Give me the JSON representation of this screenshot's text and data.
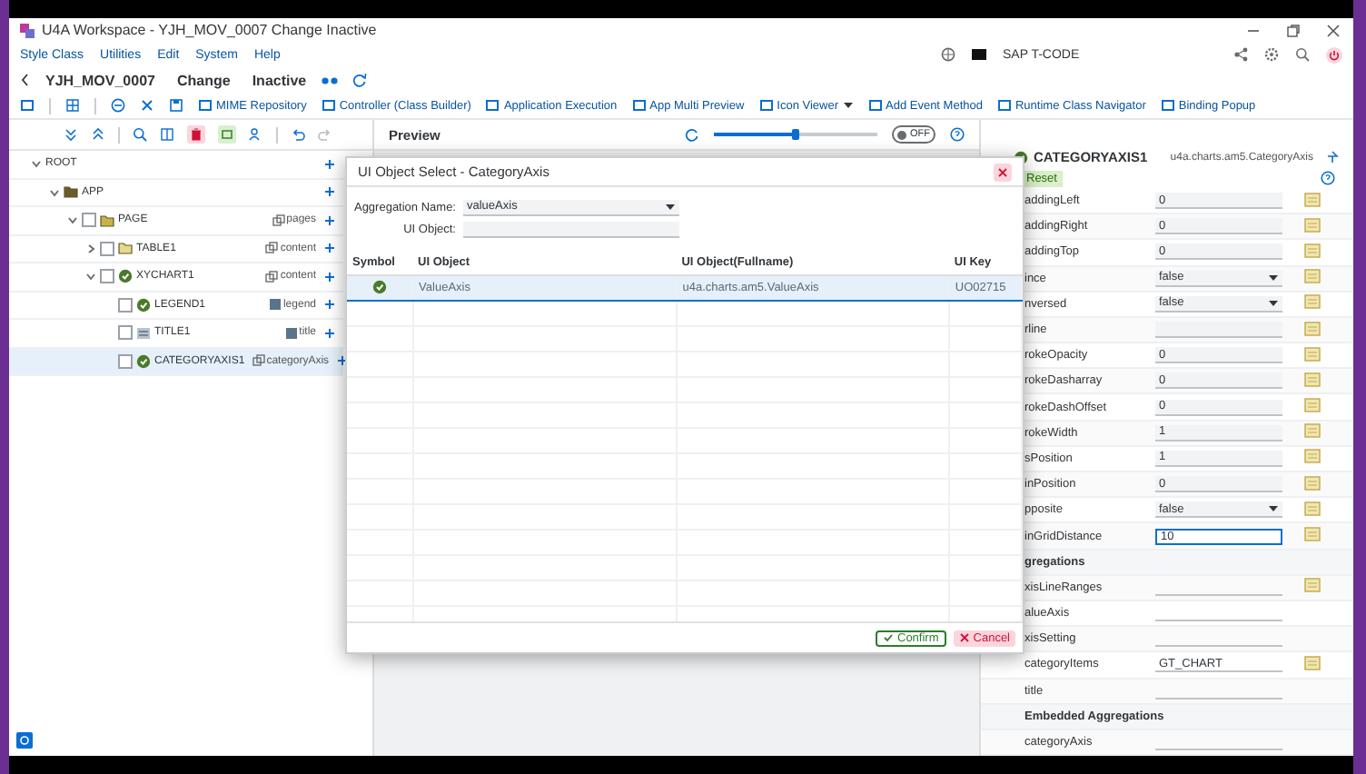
{
  "window": {
    "title": "U4A Workspace - YJH_MOV_0007 Change Inactive"
  },
  "menu": [
    {
      "label": "Style Class"
    },
    {
      "label": "Utilities"
    },
    {
      "label": "Edit"
    },
    {
      "label": "System"
    },
    {
      "label": "Help"
    }
  ],
  "tcode": {
    "placeholder": "SAP T-CODE"
  },
  "header": {
    "program": "YJH_MOV_0007",
    "mode": "Change",
    "status": "Inactive"
  },
  "toolbar": [
    {
      "label": "MIME Repository",
      "dropdown": false
    },
    {
      "label": "Controller (Class Builder)",
      "dropdown": false
    },
    {
      "label": "Application Execution",
      "dropdown": false
    },
    {
      "label": "App Multi Preview",
      "dropdown": false
    },
    {
      "label": "Icon Viewer",
      "dropdown": true
    },
    {
      "label": "Add Event Method",
      "dropdown": false
    },
    {
      "label": "Runtime Class Navigator",
      "dropdown": false
    },
    {
      "label": "Binding Popup",
      "dropdown": false
    }
  ],
  "preview": {
    "title": "Preview",
    "zoom": {
      "level": 0.5
    },
    "toggle": {
      "label": "OFF",
      "on": false
    }
  },
  "tree": [
    {
      "label": "ROOT",
      "expanded": true,
      "selected": false,
      "children": [
        {
          "label": "APP",
          "kind": "app",
          "expanded": true,
          "selected": false,
          "children": [
            {
              "label": "PAGE",
              "kind": "page",
              "aggregation": "pages",
              "expanded": true,
              "selected": false,
              "children": [
                {
                  "label": "TABLE1",
                  "kind": "table",
                  "aggregation": "content",
                  "expanded": false,
                  "selected": false
                },
                {
                  "label": "XYCHART1",
                  "kind": "chart",
                  "aggregation": "content",
                  "expanded": true,
                  "selected": false,
                  "children": [
                    {
                      "label": "LEGEND1",
                      "kind": "chart",
                      "aggregation": "legend",
                      "selected": false
                    },
                    {
                      "label": "TITLE1",
                      "kind": "title",
                      "aggregation": "title",
                      "selected": false
                    },
                    {
                      "label": "CATEGORYAXIS1",
                      "kind": "chart",
                      "aggregation": "categoryAxis",
                      "selected": true
                    }
                  ]
                }
              ]
            }
          ]
        }
      ]
    }
  ],
  "dialog": {
    "title": "UI Object Select - CategoryAxis",
    "fields": [
      {
        "label": "Aggregation Name:",
        "kind": "select",
        "value": "valueAxis"
      },
      {
        "label": "UI Object:",
        "kind": "input"
      }
    ],
    "columns": [
      "Symbol",
      "UI Object",
      "UI Object(Fullname)",
      "UI Key"
    ],
    "rows": [
      {
        "ui_object": "ValueAxis",
        "fullname": "u4a.charts.am5.ValueAxis",
        "ui_key": "UO02715",
        "selected": true
      }
    ],
    "buttons": [
      {
        "label": "Confirm",
        "kind": "confirm"
      },
      {
        "label": "Cancel",
        "kind": "cancel"
      }
    ]
  },
  "properties": {
    "title": "CATEGORYAXIS1",
    "class_name": "u4a.charts.am5.CategoryAxis",
    "reset": "Reset",
    "rows": [
      {
        "kind": "input",
        "name": "addingLeft",
        "value": "0",
        "focused": false
      },
      {
        "kind": "input",
        "name": "addingRight",
        "value": "0",
        "focused": false
      },
      {
        "kind": "input",
        "name": "addingTop",
        "value": "0",
        "focused": false
      },
      {
        "kind": "select",
        "name": "ince",
        "value": "false"
      },
      {
        "kind": "select",
        "name": "nversed",
        "value": "false"
      },
      {
        "kind": "input",
        "name": "rline",
        "focused": false
      },
      {
        "kind": "input",
        "name": "rokeOpacity",
        "value": "0",
        "focused": false
      },
      {
        "kind": "input",
        "name": "rokeDasharray",
        "value": "0",
        "focused": false
      },
      {
        "kind": "input",
        "name": "rokeDashOffset",
        "value": "0",
        "focused": false
      },
      {
        "kind": "input",
        "name": "rokeWidth",
        "value": "1",
        "focused": false
      },
      {
        "kind": "input",
        "name": "sPosition",
        "value": "1",
        "focused": false
      },
      {
        "kind": "input",
        "name": "inPosition",
        "value": "0",
        "focused": false
      },
      {
        "kind": "select",
        "name": "pposite",
        "value": "false"
      },
      {
        "kind": "input",
        "name": "inGridDistance",
        "value": "10",
        "focused": true
      },
      {
        "kind": "section",
        "name": "gregations"
      },
      {
        "kind": "aggregation",
        "name": "xisLineRanges",
        "bindable": true
      },
      {
        "kind": "aggregation",
        "name": "alueAxis",
        "bindable": false
      },
      {
        "kind": "aggregation",
        "name": "xisSetting",
        "bindable": false
      },
      {
        "kind": "aggregation",
        "name": "categoryItems",
        "value": "GT_CHART",
        "bindable": true
      },
      {
        "kind": "aggregation",
        "name": "title",
        "bindable": false
      },
      {
        "kind": "section",
        "name": "Embedded Aggregations"
      },
      {
        "kind": "aggregation",
        "name": "categoryAxis",
        "bindable": false
      }
    ]
  }
}
